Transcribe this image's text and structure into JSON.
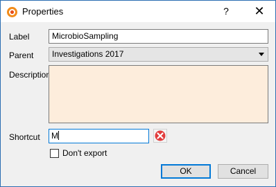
{
  "window": {
    "title": "Properties",
    "help_glyph": "?",
    "close_glyph": "✕",
    "icon": "app-logo-icon"
  },
  "form": {
    "label": {
      "caption": "Label",
      "value": "MicrobioSampling"
    },
    "parent": {
      "caption": "Parent",
      "selected": "Investigations 2017"
    },
    "description": {
      "caption": "Description",
      "value": "",
      "background": "#fdeddc"
    },
    "shortcut": {
      "caption": "Shortcut",
      "value": "M"
    },
    "dont_export": {
      "caption": "Don't export",
      "checked": false
    }
  },
  "buttons": {
    "ok": "OK",
    "cancel": "Cancel"
  },
  "colors": {
    "accent": "#0078d7",
    "clear_icon": "#e23c3c"
  }
}
